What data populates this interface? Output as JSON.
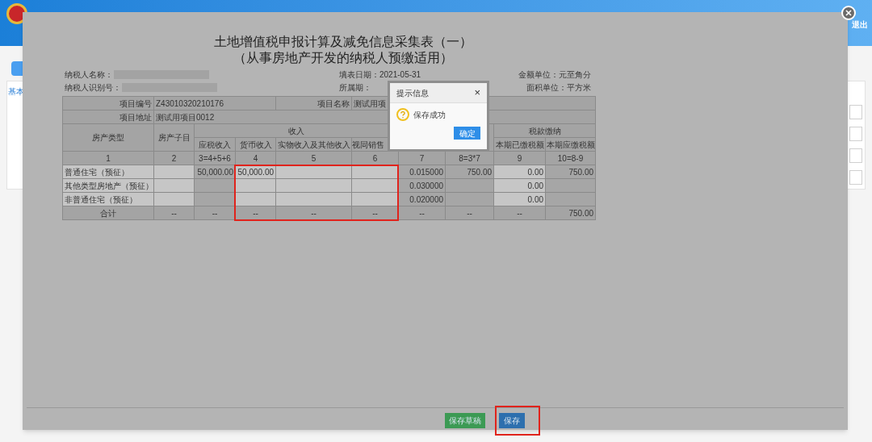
{
  "page": {
    "tab_link": "基本",
    "logout": "退出"
  },
  "modal": {
    "title": "土地增值税申报计算及减免信息采集表（一）",
    "subtitle": "（从事房地产开发的纳税人预缴适用）",
    "meta_left": [
      "纳税人名称：",
      "纳税人识别号："
    ],
    "meta_middle": [
      "填表日期：2021-05-31",
      "所属期："
    ],
    "meta_right": [
      "金额单位：元至角分",
      "面积单位：平方米"
    ],
    "table": {
      "info": [
        {
          "label": "项目编号",
          "value": "Z43010320210176",
          "label2": "项目名称",
          "value2": "测试用项"
        },
        {
          "label": "项目地址",
          "value": "测试用项目0012"
        }
      ],
      "header": {
        "property_type": "房产类型",
        "subitem": "房产子目",
        "income": "收入",
        "income_columns": [
          "应税收入",
          "货币收入",
          "实物收入及其他收入",
          "视同销售"
        ],
        "tax_payment": "税款缴纳",
        "tax_columns": [
          "本期已缴税额",
          "本期应缴税额"
        ]
      },
      "columns": [
        {
          "number": "1",
          "highlighted": false
        },
        {
          "number": "2",
          "highlighted": false
        },
        {
          "number": "3=4+5+6",
          "highlighted": false
        },
        {
          "number": "4",
          "highlighted": true
        },
        {
          "number": "5",
          "highlighted": true
        },
        {
          "number": "6",
          "highlighted": true
        },
        {
          "number": "7",
          "highlighted": false
        },
        {
          "number": "8=3*7",
          "highlighted": false
        },
        {
          "number": "9",
          "highlighted": false
        },
        {
          "number": "10=8-9",
          "highlighted": false
        }
      ],
      "rows": [
        {
          "cells": [
            {
              "text": "普通住宅（预征）",
              "kind": "label"
            },
            {
              "editable": true
            },
            {
              "text": "50,000.00",
              "editable": false
            },
            {
              "text": "50,000.00",
              "editable": true
            },
            {
              "editable": true
            },
            {
              "editable": true
            },
            {
              "text": "0.015000",
              "editable": false
            },
            {
              "text": "750.00",
              "editable": false
            },
            {
              "text": "0.00",
              "editable": true
            },
            {
              "text": "750.00",
              "editable": false
            }
          ]
        },
        {
          "cells": [
            {
              "text": "其他类型房地产（预征）",
              "kind": "label"
            },
            {
              "editable": true
            },
            {
              "editable": false
            },
            {
              "editable": true
            },
            {
              "editable": true
            },
            {
              "editable": true
            },
            {
              "text": "0.030000",
              "editable": false
            },
            {
              "editable": false
            },
            {
              "text": "0.00",
              "editable": true
            },
            {
              "editable": false
            }
          ]
        },
        {
          "cells": [
            {
              "text": "非普通住宅（预征）",
              "kind": "label"
            },
            {
              "editable": true
            },
            {
              "editable": false
            },
            {
              "editable": true
            },
            {
              "editable": true
            },
            {
              "editable": true
            },
            {
              "text": "0.020000",
              "editable": false
            },
            {
              "editable": false
            },
            {
              "text": "0.00",
              "editable": true
            },
            {
              "editable": false
            }
          ]
        }
      ],
      "total": {
        "cells": [
          "合计",
          "--",
          "--",
          "--",
          "--",
          "--",
          "--",
          "--",
          "--",
          "750.00"
        ]
      }
    },
    "buttons": [
      {
        "label": "保存草稿",
        "kind": "secondary",
        "highlighted": false
      },
      {
        "label": "保存",
        "kind": "primary",
        "highlighted": true
      }
    ]
  },
  "dialog": {
    "title": "提示信息",
    "close": "×",
    "message": "保存成功",
    "ok": "确定"
  }
}
